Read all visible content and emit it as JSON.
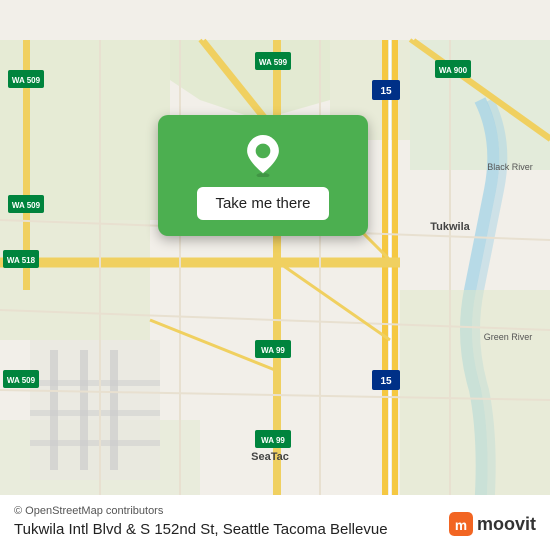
{
  "map": {
    "attribution": "© OpenStreetMap contributors",
    "location_name": "Tukwila Intl Blvd & S 152nd St, Seattle Tacoma Bellevue",
    "popup": {
      "button_label": "Take me there"
    }
  },
  "branding": {
    "moovit_label": "moovit"
  },
  "highway_labels": [
    {
      "id": "i15_n1",
      "text": "15"
    },
    {
      "id": "i15_n2",
      "text": "15"
    },
    {
      "id": "wa509_nw",
      "text": "WA 509"
    },
    {
      "id": "wa509_sw",
      "text": "WA 509"
    },
    {
      "id": "wa509_s",
      "text": "WA 509"
    },
    {
      "id": "wa518",
      "text": "WA 518"
    },
    {
      "id": "wa599",
      "text": "WA 599"
    },
    {
      "id": "wa900",
      "text": "WA 900"
    },
    {
      "id": "wa99_1",
      "text": "WA 99"
    },
    {
      "id": "wa99_2",
      "text": "WA 99"
    }
  ]
}
